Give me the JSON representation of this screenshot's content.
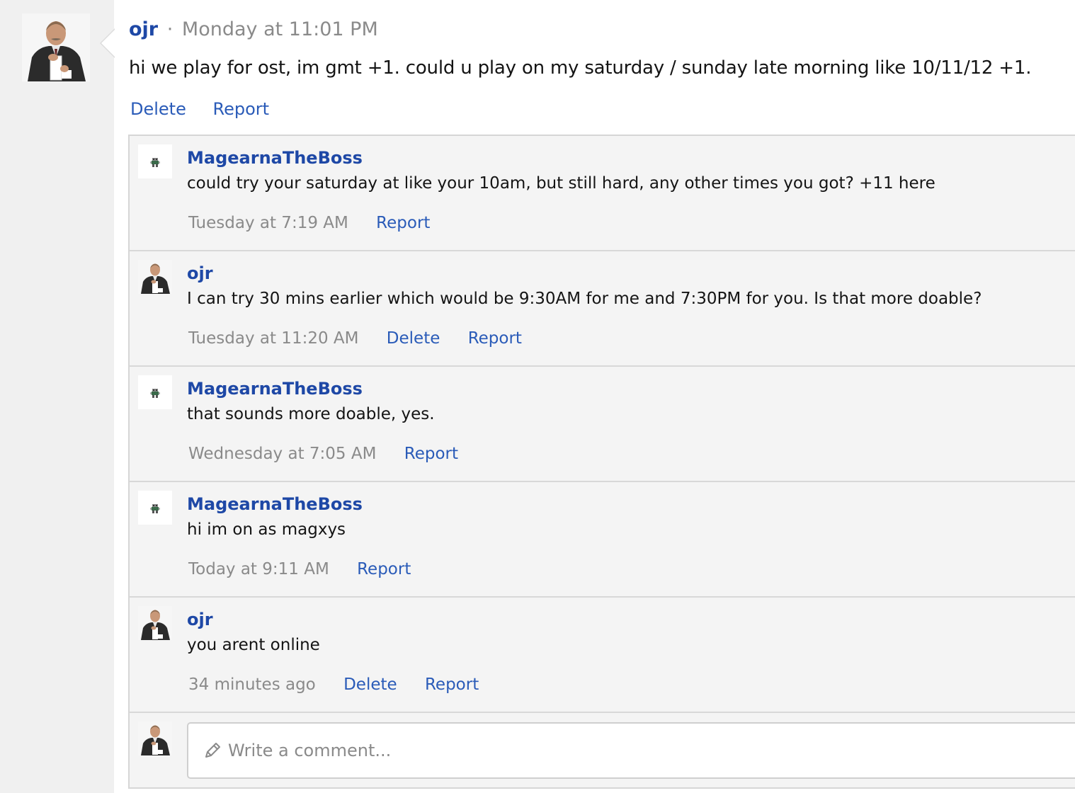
{
  "post": {
    "author": "ojr",
    "separator": "·",
    "date": "Monday at 11:01 PM",
    "body": "hi we play for ost, im gmt +1. could u play on my saturday / sunday late morning like 10/11/12 +1.",
    "actions": {
      "delete": "Delete",
      "report": "Report"
    },
    "avatar_icon": "dr-phil-photo-avatar"
  },
  "comments": [
    {
      "author": "MagearnaTheBoss",
      "text": "could try your saturday at like your 10am, but still hard, any other times you got? +11 here",
      "time": "Tuesday at 7:19 AM",
      "delete": "",
      "report": "Report",
      "avatar_icon": "pixel-sprite-avatar"
    },
    {
      "author": "ojr",
      "text": "I can try 30 mins earlier which would be 9:30AM for me and 7:30PM for you. Is that more doable?",
      "time": "Tuesday at 11:20 AM",
      "delete": "Delete",
      "report": "Report",
      "avatar_icon": "dr-phil-photo-avatar"
    },
    {
      "author": "MagearnaTheBoss",
      "text": "that sounds more doable, yes.",
      "time": "Wednesday at 7:05 AM",
      "delete": "",
      "report": "Report",
      "avatar_icon": "pixel-sprite-avatar"
    },
    {
      "author": "MagearnaTheBoss",
      "text": "hi im on as magxys",
      "time": "Today at 9:11 AM",
      "delete": "",
      "report": "Report",
      "avatar_icon": "pixel-sprite-avatar"
    },
    {
      "author": "ojr",
      "text": "you arent online",
      "time": "34 minutes ago",
      "delete": "Delete",
      "report": "Report",
      "avatar_icon": "dr-phil-photo-avatar"
    }
  ],
  "composer": {
    "placeholder": "Write a comment...",
    "icon": "pencil-icon"
  },
  "colors": {
    "link": "#2a5bb8",
    "username": "#1e48a6",
    "muted": "#8a8a8a",
    "comment_bg": "#f4f4f4",
    "gutter_bg": "#f0f0f0"
  }
}
